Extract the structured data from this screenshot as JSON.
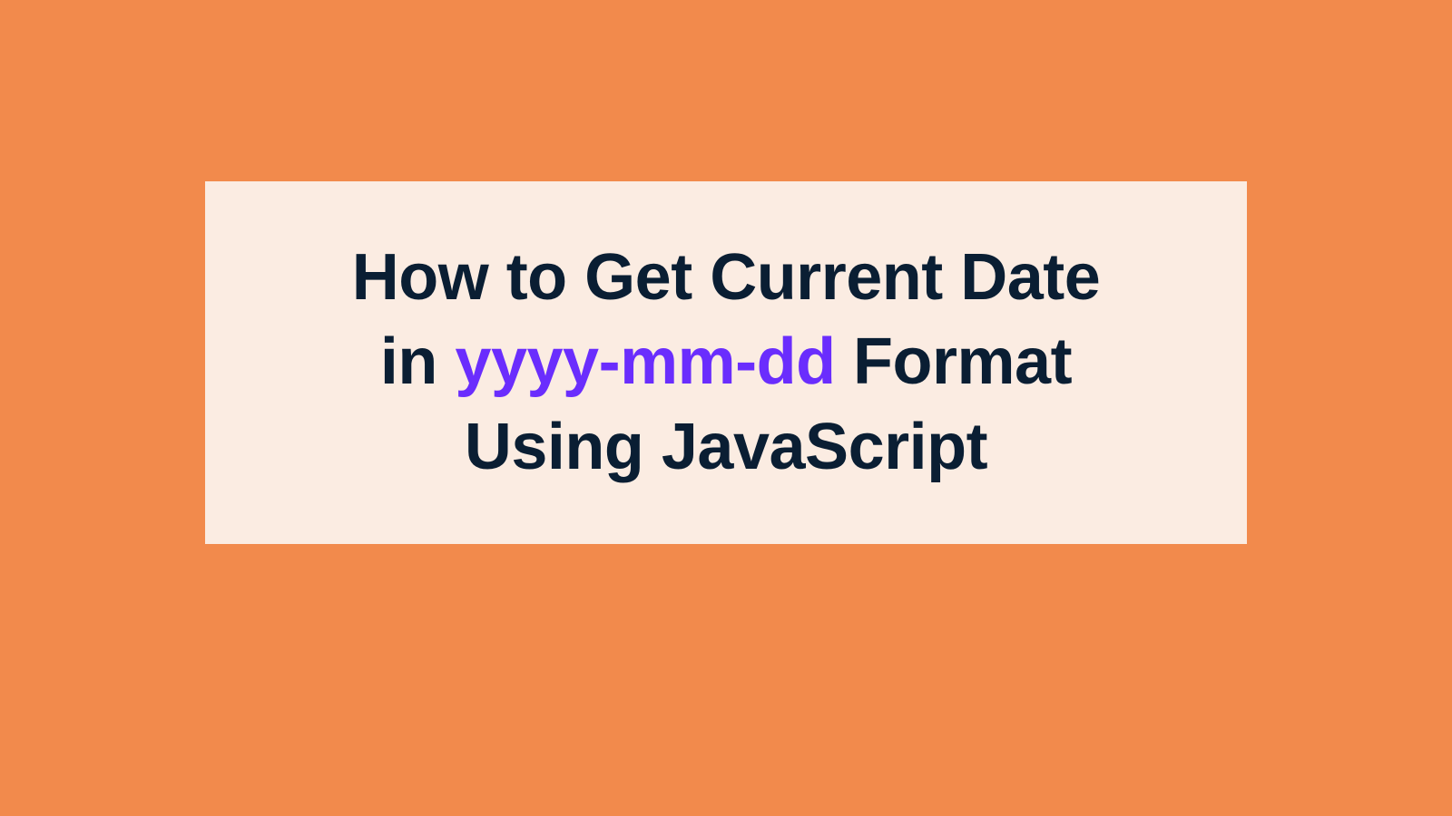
{
  "title": {
    "line1_part1": "How to Get Current Date",
    "line2_part1": "in ",
    "line2_highlight": "yyyy-mm-dd",
    "line2_part2": " Format",
    "line3": "Using JavaScript"
  },
  "colors": {
    "background": "#f28a4c",
    "card": "#fbece2",
    "text": "#0a1e33",
    "highlight": "#6a2dfd"
  }
}
